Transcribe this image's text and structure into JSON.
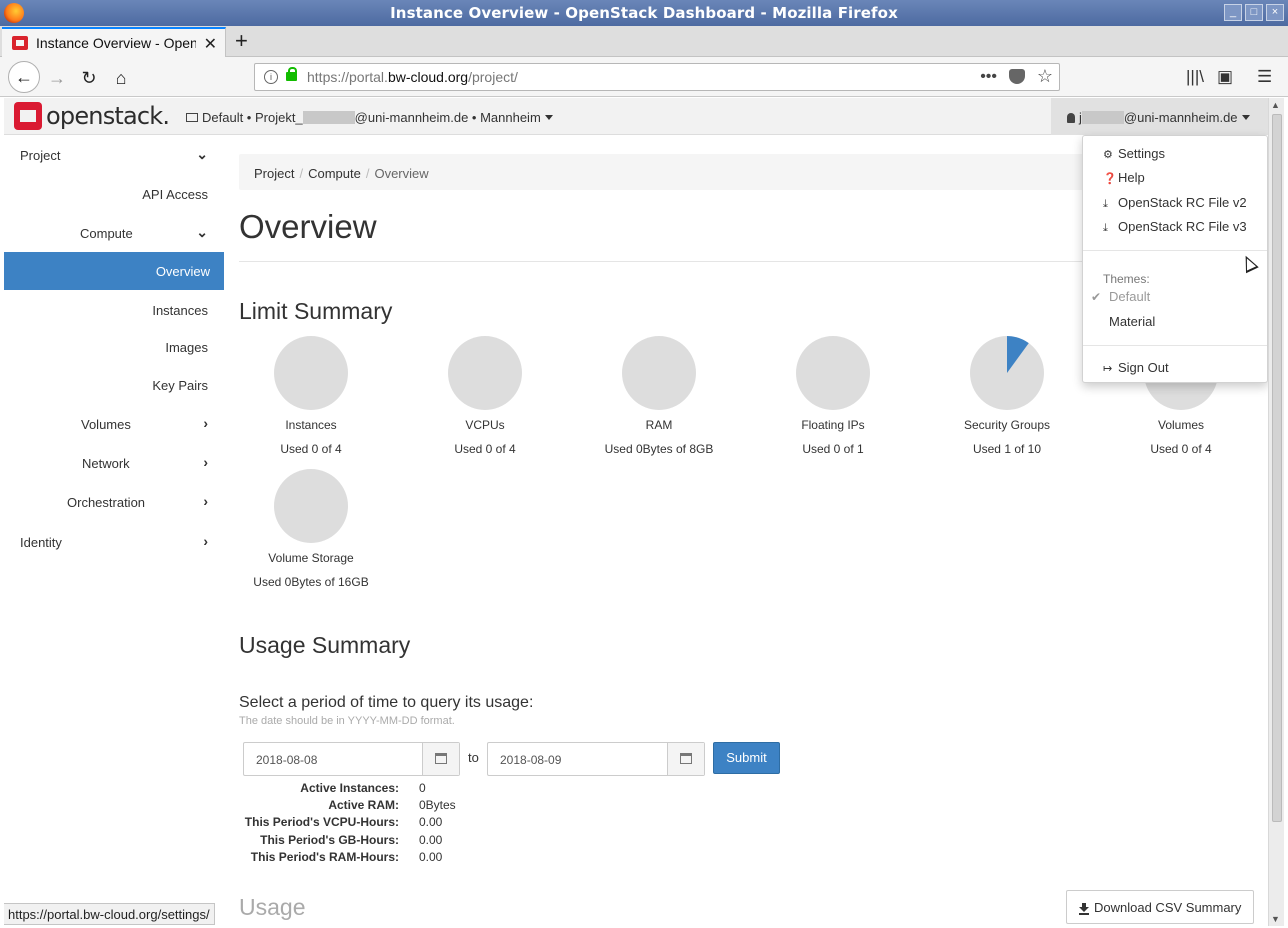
{
  "window": {
    "title": "Instance Overview - OpenStack Dashboard - Mozilla Firefox"
  },
  "browser": {
    "tab_title": "Instance Overview - OpenStack Dashboard",
    "url_prefix": "https://portal.",
    "url_domain": "bw-cloud.org",
    "url_path": "/project/",
    "status_url": "https://portal.bw-cloud.org/settings/"
  },
  "header": {
    "logo_text": "openstack.",
    "project_scope": "Default • Projekt_",
    "project_suffix": "@uni-mannheim.de • Mannheim",
    "user_prefix": "j",
    "user_suffix": "@uni-mannheim.de"
  },
  "sidebar": {
    "project": "Project",
    "api_access": "API Access",
    "compute": "Compute",
    "overview": "Overview",
    "instances": "Instances",
    "images": "Images",
    "key_pairs": "Key Pairs",
    "volumes": "Volumes",
    "network": "Network",
    "orchestration": "Orchestration",
    "identity": "Identity"
  },
  "breadcrumb": {
    "project": "Project",
    "compute": "Compute",
    "current": "Overview",
    "sep": "/"
  },
  "page": {
    "title": "Overview",
    "limit_summary": "Limit Summary",
    "usage_summary": "Usage Summary",
    "usage": "Usage"
  },
  "limits": [
    {
      "name": "Instances",
      "used": "Used 0 of 4",
      "fraction": 0
    },
    {
      "name": "VCPUs",
      "used": "Used 0 of 4",
      "fraction": 0
    },
    {
      "name": "RAM",
      "used": "Used 0Bytes of 8GB",
      "fraction": 0
    },
    {
      "name": "Floating IPs",
      "used": "Used 0 of 1",
      "fraction": 0
    },
    {
      "name": "Security Groups",
      "used": "Used 1 of 10",
      "fraction": 0.1
    },
    {
      "name": "Volumes",
      "used": "Used 0 of 4",
      "fraction": 0
    },
    {
      "name": "Volume Storage",
      "used": "Used 0Bytes of 16GB",
      "fraction": 0
    }
  ],
  "query": {
    "title": "Select a period of time to query its usage:",
    "hint": "The date should be in YYYY-MM-DD format.",
    "start": "2018-08-08",
    "to": "to",
    "end": "2018-08-09",
    "submit": "Submit"
  },
  "stats": [
    {
      "label": "Active Instances:",
      "value": "0"
    },
    {
      "label": "Active RAM:",
      "value": "0Bytes"
    },
    {
      "label": "This Period's VCPU-Hours:",
      "value": "0.00"
    },
    {
      "label": "This Period's GB-Hours:",
      "value": "0.00"
    },
    {
      "label": "This Period's RAM-Hours:",
      "value": "0.00"
    }
  ],
  "download_csv": "Download CSV Summary",
  "user_dropdown": {
    "settings": "Settings",
    "help": "Help",
    "rc_v2": "OpenStack RC File v2",
    "rc_v3": "OpenStack RC File v3",
    "themes_header": "Themes:",
    "theme_default": "Default",
    "theme_material": "Material",
    "sign_out": "Sign Out"
  },
  "colors": {
    "accent": "#3d82c4",
    "pie_bg": "#dddddd",
    "brand_red": "#da1a32"
  }
}
